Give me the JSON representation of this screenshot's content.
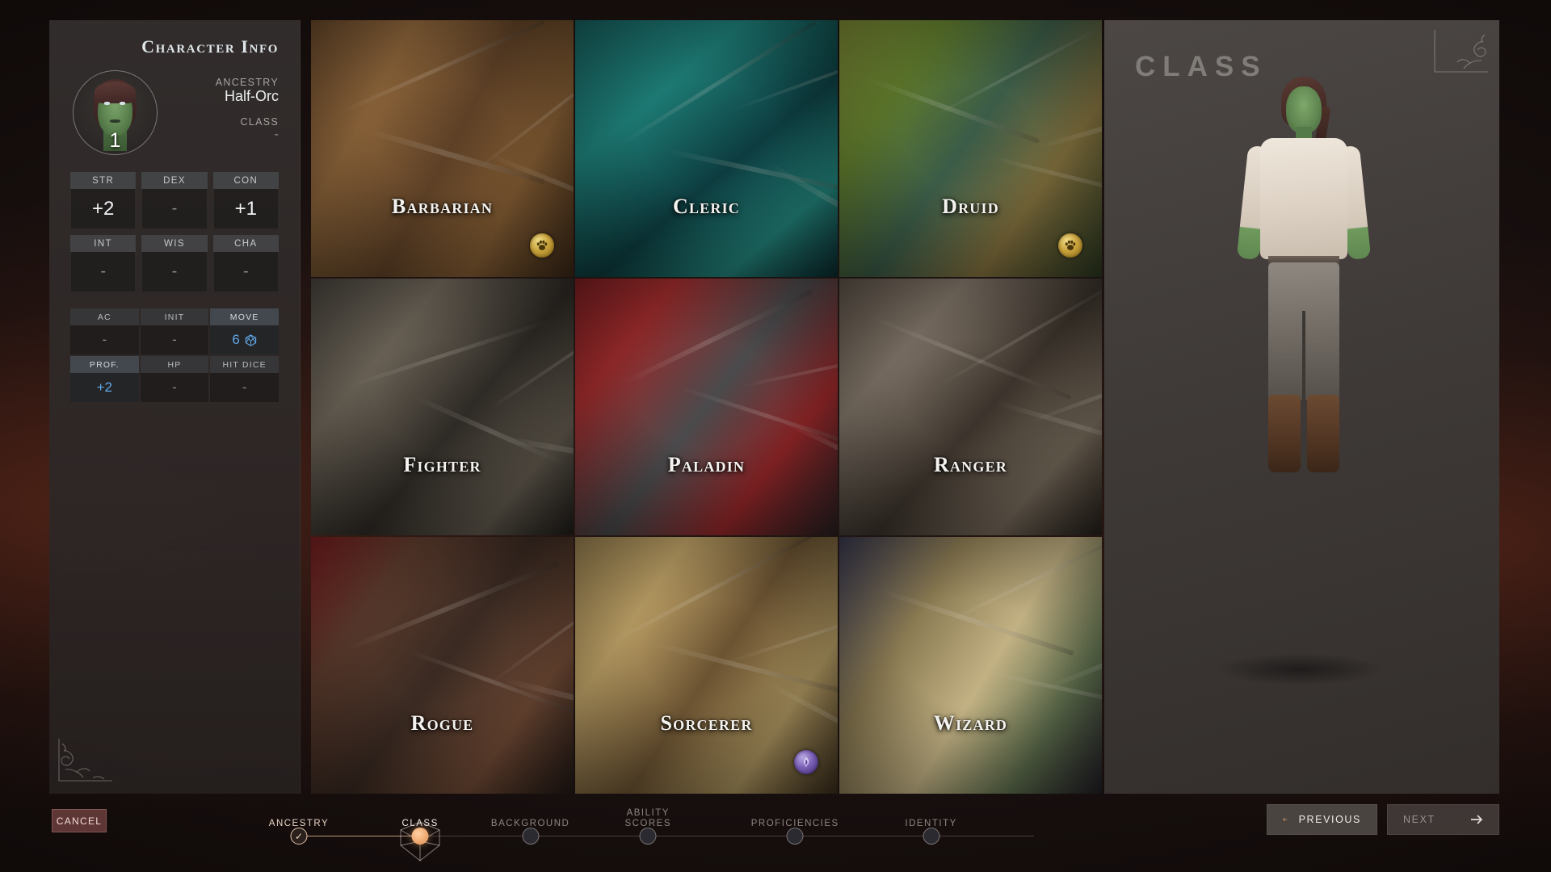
{
  "panel": {
    "title": "Character Info",
    "level": "1",
    "identity": [
      {
        "label": "ANCESTRY",
        "value": "Half-Orc"
      },
      {
        "label": "CLASS",
        "value": "-"
      }
    ],
    "abilities": [
      {
        "label": "STR",
        "value": "+2"
      },
      {
        "label": "DEX",
        "value": "-"
      },
      {
        "label": "CON",
        "value": "+1"
      },
      {
        "label": "INT",
        "value": "-"
      },
      {
        "label": "WIS",
        "value": "-"
      },
      {
        "label": "CHA",
        "value": "-"
      }
    ],
    "secondary": [
      {
        "label": "AC",
        "value": "-",
        "highlight": false,
        "icon": ""
      },
      {
        "label": "INIT",
        "value": "-",
        "highlight": false,
        "icon": ""
      },
      {
        "label": "MOVE",
        "value": "6",
        "highlight": true,
        "icon": "cube-icon"
      },
      {
        "label": "PROF.",
        "value": "+2",
        "highlight": true,
        "icon": ""
      },
      {
        "label": "HP",
        "value": "-",
        "highlight": false,
        "icon": ""
      },
      {
        "label": "HIT DICE",
        "value": "-",
        "highlight": false,
        "icon": ""
      }
    ]
  },
  "classes": [
    {
      "name": "Barbarian",
      "art": "art-barbarian",
      "badge": "beast-paw-icon"
    },
    {
      "name": "Cleric",
      "art": "art-cleric",
      "badge": ""
    },
    {
      "name": "Druid",
      "art": "art-druid",
      "badge": "beast-paw-icon"
    },
    {
      "name": "Fighter",
      "art": "art-fighter",
      "badge": ""
    },
    {
      "name": "Paladin",
      "art": "art-paladin",
      "badge": ""
    },
    {
      "name": "Ranger",
      "art": "art-ranger",
      "badge": ""
    },
    {
      "name": "Rogue",
      "art": "art-rogue",
      "badge": ""
    },
    {
      "name": "Sorcerer",
      "art": "art-sorcerer",
      "badge": "magic-flame-icon"
    },
    {
      "name": "Wizard",
      "art": "art-wizard",
      "badge": ""
    }
  ],
  "preview": {
    "title": "CLASS"
  },
  "bottom": {
    "cancel_label": "CANCEL",
    "previous_label": "PREVIOUS",
    "next_label": "NEXT",
    "steps": [
      {
        "label": "ANCESTRY",
        "state": "done"
      },
      {
        "label": "CLASS",
        "state": "active"
      },
      {
        "label": "BACKGROUND",
        "state": "pending"
      },
      {
        "label": "ABILITY\nSCORES",
        "state": "pending"
      },
      {
        "label": "PROFICIENCIES",
        "state": "pending"
      },
      {
        "label": "IDENTITY",
        "state": "pending"
      }
    ]
  },
  "colors": {
    "accent_orange": "#eda76e",
    "accent_blue": "#5fa8e8",
    "cancel_red": "#7d4747",
    "badge_gold": "#c9a33c",
    "badge_purple": "#7a5fb5"
  }
}
